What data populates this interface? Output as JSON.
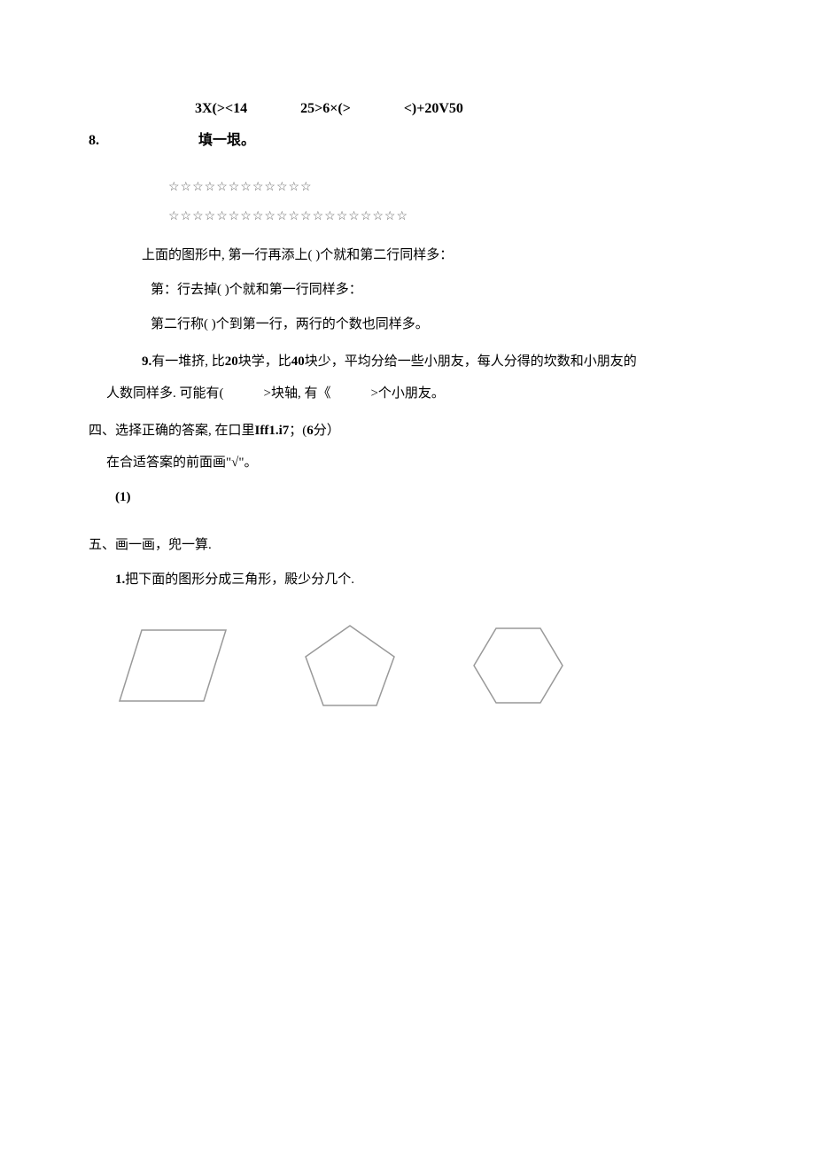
{
  "expressions": {
    "e1": "3X(><14",
    "e2": "25>6×(>",
    "e3": "<)+20V50"
  },
  "q8": {
    "num": "8.",
    "title": "填一垠。",
    "stars1": "☆☆☆☆☆☆☆☆☆☆☆☆",
    "stars2": "☆☆☆☆☆☆☆☆☆☆☆☆☆☆☆☆☆☆☆☆",
    "line1": "上面的图形中, 第一行再添上( )个就和第二行同样多：",
    "line2": "第：行去掉( )个就和第一行同样多：",
    "line3": "第二行称( )个到第一行，两行的个数也同样多。"
  },
  "q9": {
    "prefix": "9.",
    "text1": "有一堆挤, 比",
    "bold1": "20",
    "text2": "块学，比",
    "bold2": "40",
    "text3": "块少，平均分给一些小朋友，每人分得的坎数和小朋友的",
    "text4": "人数同样多. 可能有(　　　>块轴, 有《　　　>个小朋友。"
  },
  "section4": {
    "text1": "四、选择正确的答案, 在口里",
    "bold1": "Iff1.i7",
    "text2": "；(",
    "bold2": "6",
    "text3": "分）",
    "sub": "在合适答案的前面画\"√\"。",
    "item1": "(1)"
  },
  "section5": {
    "title": "五、画一画，兜一算.",
    "q1prefix": "1.",
    "q1text": "把下面的图形分成三角形，殿少分几个."
  }
}
